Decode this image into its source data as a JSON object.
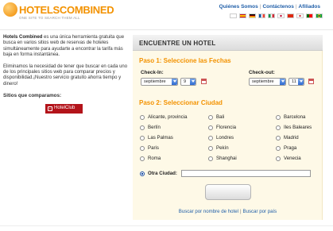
{
  "brand": {
    "name": "HOTELSCOMBINED",
    "tagline": "ONE SITE TO SEARCH THEM ALL",
    "accent_color": "#f39200"
  },
  "top_links": [
    "Quiénes Somos",
    "Contáctenos",
    "Afiliados"
  ],
  "flags": [
    "uk-flag",
    "spain-flag",
    "germany-flag",
    "france-flag",
    "italy-flag",
    "japan-flag",
    "china-flag",
    "korea-flag",
    "portugal-flag",
    "brazil-flag"
  ],
  "intro": {
    "p1_strong": "Hotels Combined",
    "p1_rest": " es una única herramienta gratuita que busca en varios sitios web de reservas de hoteles simultáneamente para ayudarte a encontrar la tarifa más baja en forma instantánea.",
    "p2": "Eliminamos la necesidad de tener que buscar en cada uno de los principales sitios web para comparar precios y disponibilidad.¡Nuestro servicio gratuito ahorra tiempo y dinero!",
    "compare_title": "Sitios que comparamos:",
    "partner_logo": "HotelClub"
  },
  "panel": {
    "title": "ENCUENTRE UN HOTEL",
    "step1": "Paso 1: Seleccione las Fechas",
    "checkin_label": "Check-In:",
    "checkout_label": "Check-out:",
    "checkin_month": "septiembre",
    "checkin_day": "9",
    "checkout_month": "septiembre",
    "checkout_day": "11",
    "step2": "Paso 2: Seleccionar Ciudad",
    "cities": [
      "Alicante, provincia",
      "Bali",
      "Barcelona",
      "Berlín",
      "Florencia",
      "Iles Baleares",
      "Las Palmas",
      "Londres",
      "Madrid",
      "Paris",
      "Pekín",
      "Praga",
      "Roma",
      "Shanghai",
      "Venecia"
    ],
    "other_city_label": "Otra Ciudad:",
    "other_city_value": "",
    "link_name": "Buscar por nombre de hotel",
    "link_country": "Buscar por país"
  }
}
